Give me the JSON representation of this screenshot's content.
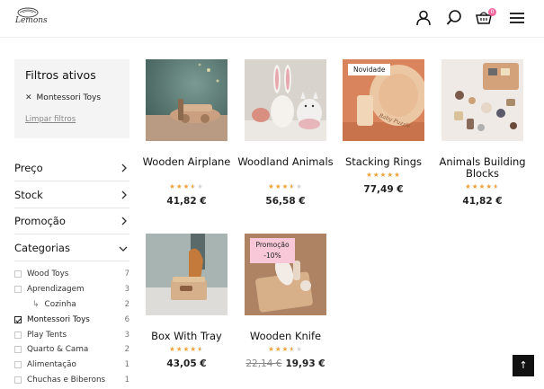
{
  "header": {
    "logo_text": "Lemons",
    "cart_count": "0"
  },
  "sidebar": {
    "filters_title": "Filtros ativos",
    "active_filter": "Montessori Toys",
    "clear_label": "Limpar filtros",
    "facets": [
      "Preço",
      "Stock",
      "Promoção",
      "Categorias"
    ],
    "categories": [
      {
        "name": "Wood Toys",
        "count": "7",
        "checked": false
      },
      {
        "name": "Aprendizagem",
        "count": "3",
        "checked": false
      },
      {
        "name": "Cozinha",
        "count": "2",
        "checked": false,
        "sub": true
      },
      {
        "name": "Montessori Toys",
        "count": "6",
        "checked": true
      },
      {
        "name": "Play Tents",
        "count": "3",
        "checked": false
      },
      {
        "name": "Quarto & Cama",
        "count": "2",
        "checked": false
      },
      {
        "name": "Alimentação",
        "count": "1",
        "checked": false
      },
      {
        "name": "Chuchas e Biberons",
        "count": "1",
        "checked": false
      }
    ]
  },
  "products": [
    {
      "name": "Wooden Airplane",
      "rating": 3.5,
      "price": "41,82 €"
    },
    {
      "name": "Woodland Animals",
      "rating": 3.5,
      "price": "56,58 €"
    },
    {
      "name": "Stacking Rings",
      "rating": 5,
      "price": "77,49 €",
      "badge": "Novidade"
    },
    {
      "name": "Animals Building Blocks",
      "rating": 4.5,
      "price": "41,82 €"
    },
    {
      "name": "Box With Tray",
      "rating": 4.5,
      "price": "43,05 €"
    },
    {
      "name": "Wooden Knife",
      "rating": 3.5,
      "old_price": "22,14 €",
      "price": "19,93 €",
      "promo_label": "Promoção",
      "promo_pct": "-10%"
    }
  ],
  "colors": {
    "star": "#f0a23a",
    "star_empty": "#d6d6d6",
    "badge_promo": "#f8c8d8",
    "cart_badge": "#f06aa0"
  },
  "back_to_top_icon": "arrow-up-icon"
}
